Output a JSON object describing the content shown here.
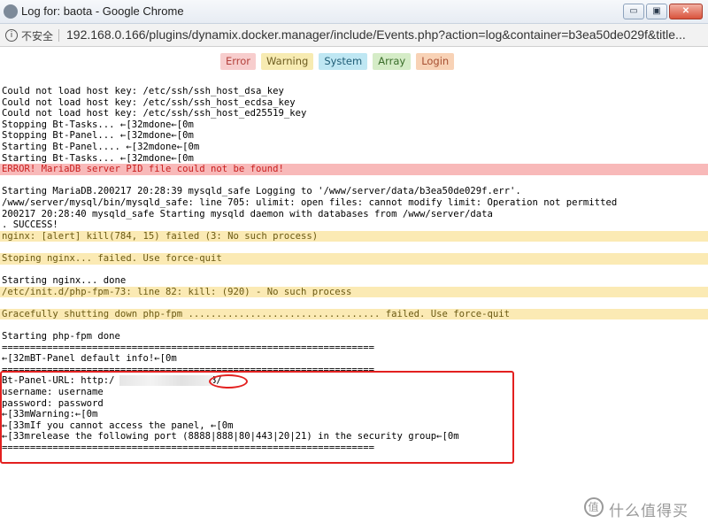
{
  "window": {
    "title": "Log for: baota - Google Chrome",
    "minimize_label": "▭",
    "restore_label": "▣",
    "close_label": "✕"
  },
  "address_bar": {
    "security_label": "不安全",
    "url": "192.168.0.166/plugins/dynamix.docker.manager/include/Events.php?action=log&container=b3ea50de029f&title..."
  },
  "filters": {
    "error": "Error",
    "warning": "Warning",
    "system": "System",
    "array": "Array",
    "login": "Login"
  },
  "log": {
    "l1": "Could not load host key: /etc/ssh/ssh_host_dsa_key",
    "l2": "Could not load host key: /etc/ssh/ssh_host_ecdsa_key",
    "l3": "Could not load host key: /etc/ssh/ssh_host_ed25519_key",
    "l4": "Stopping Bt-Tasks... ←[32mdone←[0m",
    "l5": "Stopping Bt-Panel... ←[32mdone←[0m",
    "l6": "Starting Bt-Panel.... ←[32mdone←[0m",
    "l7": "Starting Bt-Tasks... ←[32mdone←[0m",
    "l8": "ERROR! MariaDB server PID file could not be found!",
    "l9": "Starting MariaDB.200217 20:28:39 mysqld_safe Logging to '/www/server/data/b3ea50de029f.err'.",
    "l10": "/www/server/mysql/bin/mysqld_safe: line 705: ulimit: open files: cannot modify limit: Operation not permitted",
    "l11": "200217 20:28:40 mysqld_safe Starting mysqld daemon with databases from /www/server/data",
    "l12": ". SUCCESS!",
    "l13": "nginx: [alert] kill(784, 15) failed (3: No such process)",
    "l14": "Stoping nginx... failed. Use force-quit",
    "l15": "Starting nginx... done",
    "l16": "/etc/init.d/php-fpm-73: line 82: kill: (920) - No such process",
    "l17": "Gracefully shutting down php-fpm .................................. failed. Use force-quit",
    "l18": "Starting php-fpm done",
    "l19": "==================================================================",
    "l20": "←[32mBT-Panel default info!←[0m",
    "l21": "==================================================================",
    "l22": "Bt-Panel-URL: http:/              8888/",
    "l23": "username: username",
    "l24": "password: password",
    "l25": "←[33mWarning:←[0m",
    "l26": "←[33mIf you cannot access the panel, ←[0m",
    "l27": "←[33mrelease the following port (8888|888|80|443|20|21) in the security group←[0m",
    "l28": "=================================================================="
  },
  "watermark": {
    "logo": "值",
    "text": "什么值得买"
  },
  "colors": {
    "error_bg": "#f8b9b9",
    "warning_bg": "#fbeab4",
    "annotation_red": "#e3201f"
  }
}
